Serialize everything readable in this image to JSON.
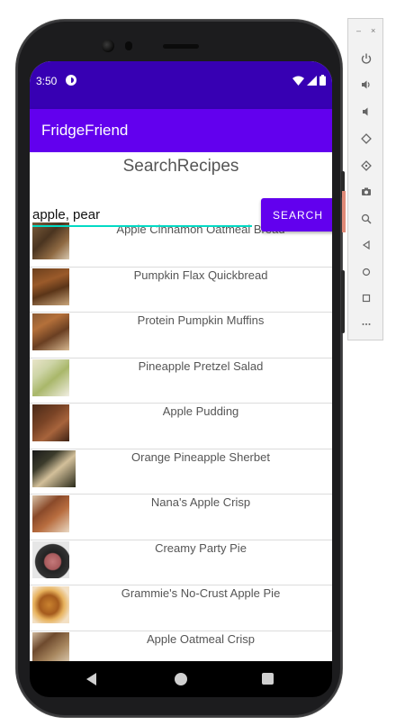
{
  "status_bar": {
    "time": "3:50"
  },
  "app_bar": {
    "title": "FridgeFriend"
  },
  "search": {
    "heading": "SearchRecipes",
    "input_value": "apple, pear",
    "button_label": "SEARCH"
  },
  "recipes": [
    {
      "title": "Apple Cinnamon Oatmeal Bread"
    },
    {
      "title": "Pumpkin Flax Quickbread"
    },
    {
      "title": "Protein Pumpkin Muffins"
    },
    {
      "title": "Pineapple Pretzel Salad"
    },
    {
      "title": "Apple Pudding"
    },
    {
      "title": "Orange Pineapple Sherbet"
    },
    {
      "title": "Nana's Apple Crisp"
    },
    {
      "title": "Creamy Party Pie"
    },
    {
      "title": "Grammie's No-Crust Apple Pie"
    },
    {
      "title": "Apple Oatmeal Crisp"
    }
  ],
  "colors": {
    "primary": "#6200ee",
    "primary_dark": "#3700b3",
    "accent": "#03dac5"
  },
  "icons": {
    "status": [
      "wifi-icon",
      "signal-icon",
      "battery-icon"
    ],
    "nav": [
      "back-icon",
      "home-icon",
      "recents-icon"
    ],
    "emulator": [
      "power-icon",
      "volume-up-icon",
      "volume-down-icon",
      "rotate-left-icon",
      "rotate-right-icon",
      "camera-icon",
      "zoom-icon",
      "back-icon",
      "home-icon",
      "overview-icon",
      "more-icon"
    ]
  }
}
